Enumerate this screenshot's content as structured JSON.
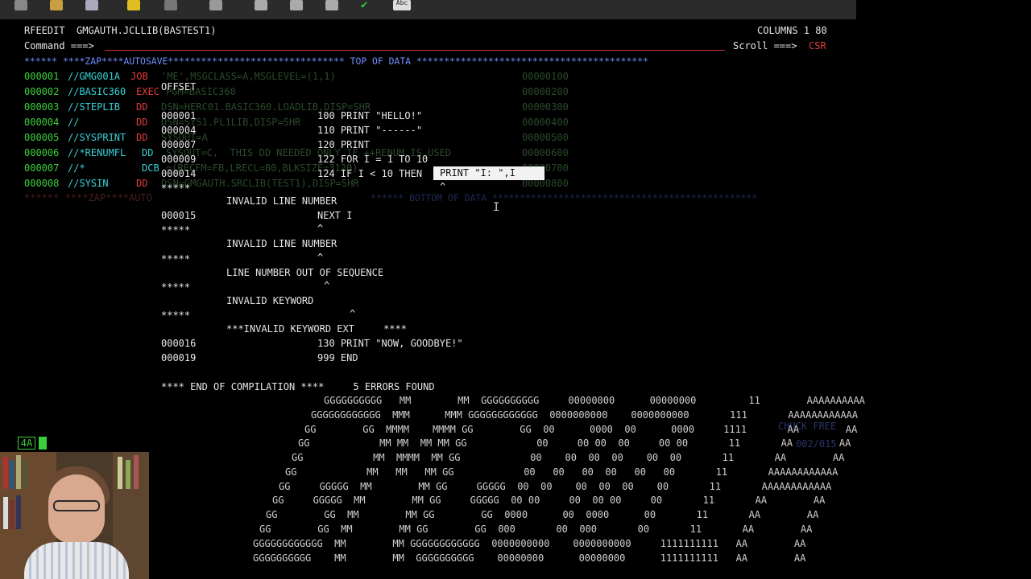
{
  "toolbar": {
    "icons": [
      "copy-icon",
      "paste-icon",
      "document-icon",
      "broom-icon",
      "eraser-icon",
      "printer-icon",
      "window-icon",
      "trash-icon",
      "export-icon",
      "checkmark-icon",
      "abc-icon"
    ],
    "abc_label": "Abc"
  },
  "editor": {
    "title": "RFEEDIT  GMGAUTH.JCLLIB(BASTEST1)",
    "columns": "COLUMNS 1 80",
    "command_label": "Command ===>",
    "scroll_label": "Scroll ===>",
    "scroll_value": "CSR",
    "top_of_data": "****** ****ZAP****AUTOSAVE******************************** TOP OF DATA ******************************************",
    "bottom_of_data": "****** ****ZAP****AUTO",
    "bottom_tail": "****** BOTTOM OF DATA ************************************************",
    "lines": [
      {
        "num": "000001",
        "label": "//GMG001A",
        "op": "JOB",
        "rest": "'ME',MSGCLASS=A,MSGLEVEL=(1,1)",
        "seq": "00000100"
      },
      {
        "num": "000002",
        "label": "//BASIC360",
        "op": "EXEC",
        "rest": "PGM=BASIC360",
        "seq": "00000200"
      },
      {
        "num": "000003",
        "label": "//STEPLIB",
        "op": "DD",
        "rest": "DSN=HERC01.BASIC360.LOADLIB,DISP=SHR",
        "seq": "00000300"
      },
      {
        "num": "000004",
        "label": "//",
        "op": "DD",
        "rest": "DSN=SYS1.PL1LIB,DISP=SHR",
        "seq": "00000400"
      },
      {
        "num": "000005",
        "label": "//SYSPRINT",
        "op": "DD",
        "rest": "SYSOUT=A",
        "seq": "00000500"
      },
      {
        "num": "000006",
        "label": "//*RENUMFL",
        "op": "DD",
        "rest": "SYSOUT=C,  THIS DD NEEDED ONLY IF ++RENUM IS USED",
        "seq": "00000600"
      },
      {
        "num": "000007",
        "label": "//*",
        "op": "DCB",
        "rest": "=(RECFM=FB,LRECL=80,BLKSIZE=3120)",
        "seq": "00000700"
      },
      {
        "num": "000008",
        "label": "//SYSIN",
        "op": "DD",
        "rest": "DSN=GMGAUTH.SRCLIB(TEST1),DISP=SHR",
        "seq": "00000800"
      }
    ],
    "status_box": "4A",
    "ghost_right": [
      "CHUCK FREE",
      "002/015"
    ]
  },
  "listing": {
    "offset_header": "OFFSET",
    "rows": [
      {
        "a": "000001",
        "b": "100 PRINT \"HELLO!\""
      },
      {
        "a": "000004",
        "b": "110 PRINT \"------\""
      },
      {
        "a": "000007",
        "b": "120 PRINT"
      },
      {
        "a": "000009",
        "b": "122 FOR I = 1 TO 10"
      },
      {
        "a": "000014",
        "b": "124 IF I < 10 THEN"
      }
    ],
    "tooltip": "PRINT \"I: \",I",
    "err1_stars": "*****",
    "err1_caret": "^",
    "err1_msg": "INVALID LINE NUMBER",
    "row15_num": "000015",
    "row15_text": "NEXT I",
    "err2_stars": "*****",
    "err2_caret": "^",
    "err2_msg": "INVALID LINE NUMBER",
    "err3_stars": "*****",
    "err3_caret": "^",
    "err3_msg": "LINE NUMBER OUT OF SEQUENCE",
    "err4_stars": "*****",
    "err4_caret": "^",
    "err4_msg": "INVALID KEYWORD",
    "err5_stars": "*****",
    "err5_caret": "^",
    "err5_msg": "***INVALID KEYWORD EXT     ****",
    "row16_num": "000016",
    "row16_text": "130 PRINT \"NOW, GOODBYE!\"",
    "row19_num": "000019",
    "row19_text": "999 END",
    "end_msg": "**** END OF COMPILATION ****     5 ERRORS FOUND"
  },
  "banner": [
    "GGGGGGGGGG   MM        MM  GGGGGGGGGG     00000000      00000000         11        AAAAAAAAAA",
    "GGGGGGGGGGGG  MMM      MMM GGGGGGGGGGGG  0000000000    0000000000       111       AAAAAAAAAAAA",
    "GG        GG  MMMM    MMMM GG        GG  00      0000  00      0000     1111       AA        AA",
    "GG            MM MM  MM MM GG            00     00 00  00     00 00       11       AA        AA",
    "GG            MM  MMMM  MM GG            00    00  00  00    00  00       11       AA        AA",
    "GG            MM   MM   MM GG            00   00   00  00   00   00       11       AAAAAAAAAAAA",
    "GG     GGGGG  MM        MM GG     GGGGG  00  00    00  00  00    00       11       AAAAAAAAAAAA",
    "GG     GGGGG  MM        MM GG     GGGGG  00 00     00  00 00     00       11       AA        AA",
    "GG        GG  MM        MM GG        GG  0000      00  0000      00       11       AA        AA",
    "GG        GG  MM        MM GG        GG  000       00  000       00       11       AA        AA",
    "GGGGGGGGGGGG  MM        MM GGGGGGGGGGGG  0000000000    0000000000     1111111111   AA        AA",
    "GGGGGGGGGG    MM        MM  GGGGGGGGGG    00000000      00000000      1111111111   AA        AA"
  ],
  "colors": {
    "green": "#3ccf3c",
    "red": "#e23a3a",
    "blue": "#6f8dff",
    "cyan": "#3ad0d6",
    "yellow": "#dfe04a"
  }
}
